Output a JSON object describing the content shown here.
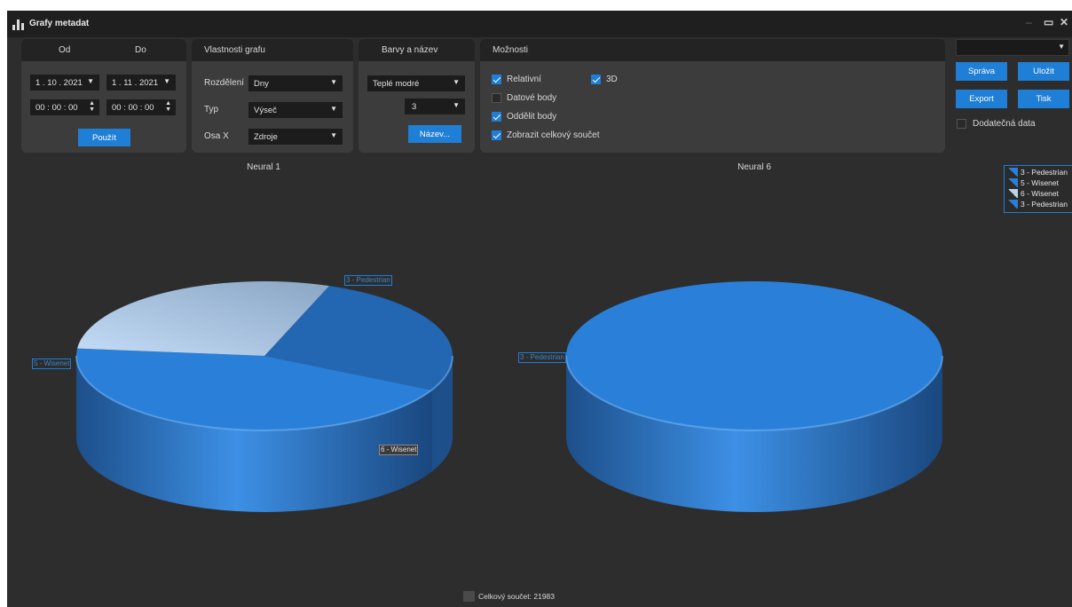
{
  "window": {
    "title": "Grafy metadat",
    "minimize": "–",
    "maximize": "▭",
    "close": "✕"
  },
  "date_panel": {
    "from_label": "Od",
    "to_label": "Do",
    "from_date": "1 . 10 . 2021",
    "to_date": "1 . 11 . 2021",
    "from_time": "00 : 00 : 00",
    "to_time": "00 : 00 : 00",
    "apply_label": "Použít"
  },
  "props_panel": {
    "title": "Vlastnosti grafu",
    "split_label": "Rozdělení",
    "split_value": "Dny",
    "type_label": "Typ",
    "type_value": "Výseč",
    "xaxis_label": "Osa X",
    "xaxis_value": "Zdroje"
  },
  "color_panel": {
    "title": "Barvy a název",
    "palette_value": "Teplé modré",
    "count_value": "3",
    "name_button": "Název..."
  },
  "options_panel": {
    "title": "Možnosti",
    "relative_label": "Relativní",
    "relative_checked": true,
    "threed_label": "3D",
    "threed_checked": true,
    "datapoints_label": "Datové body",
    "datapoints_checked": false,
    "separate_label": "Oddělit body",
    "separate_checked": true,
    "showtotal_label": "Zobrazit celkový součet",
    "showtotal_checked": true
  },
  "right_panel": {
    "select_value": "",
    "manage_label": "Správa",
    "save_label": "Uložit",
    "export_label": "Export",
    "print_label": "Tisk",
    "extra_label": "Dodatečná data",
    "extra_checked": false
  },
  "chart_data": [
    {
      "type": "pie",
      "title": "Neural 1",
      "labels": [
        "3 - Pedestrian",
        "5 - Wisenet",
        "6 - Wisenet"
      ],
      "values": [
        27,
        44,
        29
      ],
      "colors": [
        "#2366b2",
        "#2a7fd8",
        "#9fbcd9"
      ],
      "three_d": true
    },
    {
      "type": "pie",
      "title": "Neural 6",
      "labels": [
        "3 - Pedestrian"
      ],
      "values": [
        100
      ],
      "colors": [
        "#2a7fd8"
      ],
      "three_d": true
    }
  ],
  "legend": {
    "items": [
      {
        "label": "3 - Pedestrian",
        "color": "#2a7fd8"
      },
      {
        "label": "5 - Wisenet",
        "color": "#2a7fd8"
      },
      {
        "label": "6 - Wisenet",
        "color": "#bcd3ec"
      },
      {
        "label": "3 - Pedestrian",
        "color": "#2a7fd8"
      }
    ]
  },
  "total": {
    "label": "Celkový součet: 21983"
  }
}
